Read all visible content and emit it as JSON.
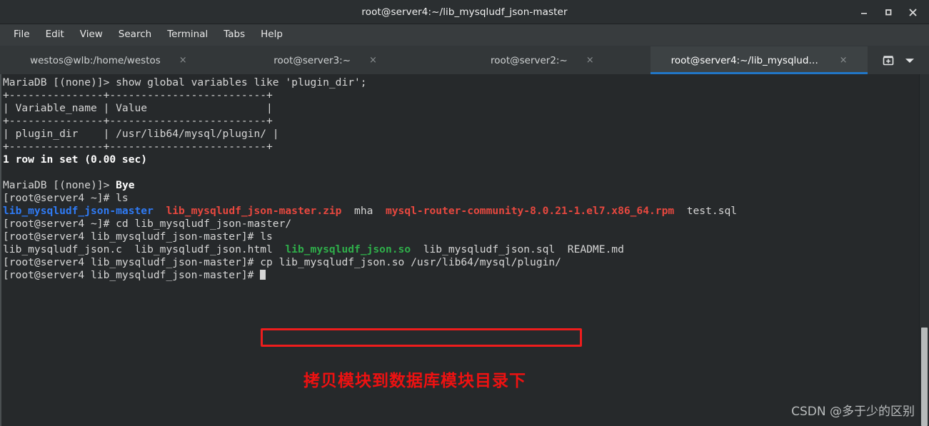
{
  "window": {
    "title": "root@server4:~/lib_mysqludf_json-master",
    "controls": [
      {
        "name": "minimize",
        "glyph": "minimize-icon"
      },
      {
        "name": "maximize",
        "glyph": "maximize-icon"
      },
      {
        "name": "close",
        "glyph": "close-icon"
      }
    ]
  },
  "menubar": {
    "items": [
      {
        "label": "File"
      },
      {
        "label": "Edit"
      },
      {
        "label": "View"
      },
      {
        "label": "Search"
      },
      {
        "label": "Terminal"
      },
      {
        "label": "Tabs"
      },
      {
        "label": "Help"
      }
    ]
  },
  "tabbar": {
    "tabs": [
      {
        "label": "westos@wlb:/home/westos",
        "active": false,
        "close": "×"
      },
      {
        "label": "root@server3:~",
        "active": false,
        "close": "×"
      },
      {
        "label": "root@server2:~",
        "active": false,
        "close": "×"
      },
      {
        "label": "root@server4:~/lib_mysqludf_jso…",
        "active": true,
        "close": "×"
      }
    ],
    "actions": [
      {
        "name": "new-tab-icon",
        "label": "⊞"
      },
      {
        "name": "tab-list-chevron-down-icon",
        "label": "▾"
      }
    ],
    "active_tab_indicator_color": "#2176c7"
  },
  "terminal": {
    "background": "#26292b",
    "foreground": "#d6d6d6",
    "colors": {
      "directory_blue": "#2f7bf5",
      "archive_red": "#e8483f",
      "executable_green": "#2fae4a",
      "bold_white": "#ffffff"
    },
    "lines": [
      {
        "segments": [
          {
            "text": "MariaDB [(none)]> show global variables like 'plugin_dir';",
            "color": "default"
          }
        ]
      },
      {
        "segments": [
          {
            "text": "+---------------+-------------------------+",
            "color": "default"
          }
        ]
      },
      {
        "segments": [
          {
            "text": "| Variable_name | Value                   |",
            "color": "default"
          }
        ]
      },
      {
        "segments": [
          {
            "text": "+---------------+-------------------------+",
            "color": "default"
          }
        ]
      },
      {
        "segments": [
          {
            "text": "| plugin_dir    | /usr/lib64/mysql/plugin/ |",
            "color": "default"
          }
        ]
      },
      {
        "segments": [
          {
            "text": "+---------------+-------------------------+",
            "color": "default"
          }
        ]
      },
      {
        "segments": [
          {
            "text": "1 row in set (0.00 sec)",
            "color": "bold"
          }
        ]
      },
      {
        "segments": [
          {
            "text": "",
            "color": "default"
          }
        ]
      },
      {
        "segments": [
          {
            "text": "MariaDB [(none)]> ",
            "color": "default"
          },
          {
            "text": "Bye",
            "color": "bold"
          }
        ]
      },
      {
        "segments": [
          {
            "text": "[root@server4 ~]# ls",
            "color": "default"
          }
        ]
      },
      {
        "segments": [
          {
            "text": "lib_mysqludf_json-master",
            "color": "blue"
          },
          {
            "text": "  ",
            "color": "default"
          },
          {
            "text": "lib_mysqludf_json-master.zip",
            "color": "red"
          },
          {
            "text": "  mha  ",
            "color": "default"
          },
          {
            "text": "mysql-router-community-8.0.21-1.el7.x86_64.rpm",
            "color": "red"
          },
          {
            "text": "  test.sql",
            "color": "default"
          }
        ]
      },
      {
        "segments": [
          {
            "text": "[root@server4 ~]# cd lib_mysqludf_json-master/",
            "color": "default"
          }
        ]
      },
      {
        "segments": [
          {
            "text": "[root@server4 lib_mysqludf_json-master]# ls",
            "color": "default"
          }
        ]
      },
      {
        "segments": [
          {
            "text": "lib_mysqludf_json.c  lib_mysqludf_json.html  ",
            "color": "default"
          },
          {
            "text": "lib_mysqludf_json.so",
            "color": "green"
          },
          {
            "text": "  lib_mysqludf_json.sql  README.md",
            "color": "default"
          }
        ]
      },
      {
        "segments": [
          {
            "text": "[root@server4 lib_mysqludf_json-master]# cp lib_mysqludf_json.so /usr/lib64/mysql/plugin/",
            "color": "default"
          }
        ]
      },
      {
        "segments": [
          {
            "text": "[root@server4 lib_mysqludf_json-master]# ",
            "color": "default"
          },
          {
            "text": "",
            "color": "cursor"
          }
        ]
      }
    ],
    "highlight_box": {
      "name": "cp-command-highlight",
      "color": "#ee1d1d",
      "content": "cp lib_mysqludf_json.so /usr/lib64/mysql/plugin/"
    }
  },
  "annotation": {
    "text": "拷贝模块到数据库模块目录下",
    "color": "#ee1111"
  },
  "watermark": {
    "text": "CSDN @多于少的区别"
  }
}
